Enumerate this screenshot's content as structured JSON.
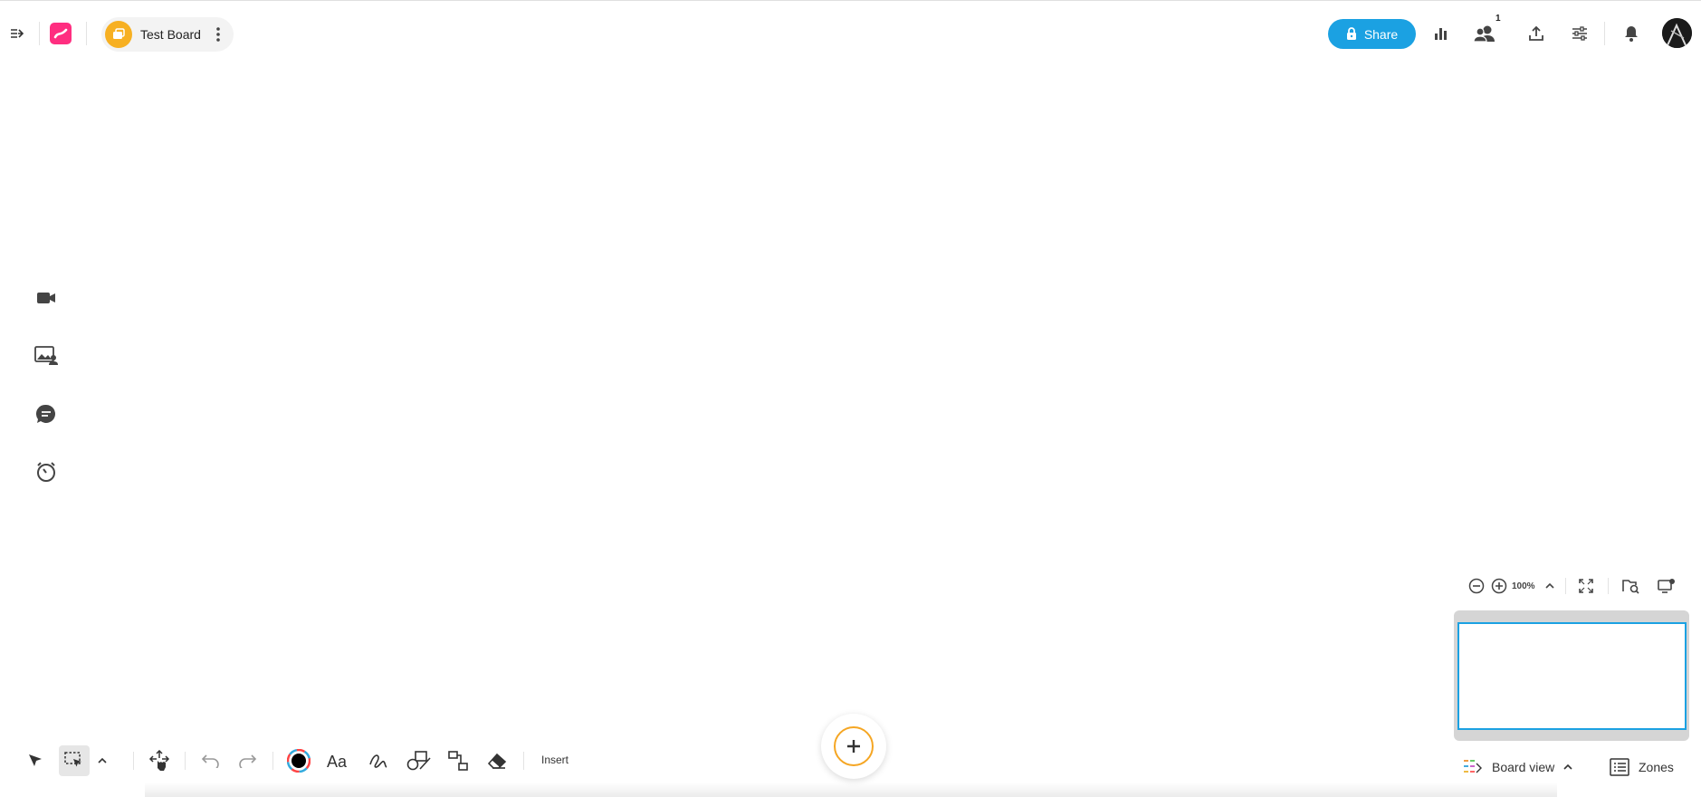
{
  "header": {
    "board_title": "Test Board",
    "share_label": "Share",
    "collaborators_count": "1"
  },
  "zoom": {
    "level": "100%"
  },
  "toolbar": {
    "insert_label": "Insert"
  },
  "footer": {
    "board_view_label": "Board view",
    "zones_label": "Zones"
  },
  "colors": {
    "brand_logo": "#ff2e80",
    "board_icon": "#f7b022",
    "share_button": "#1ba1e2",
    "fab_ring": "#f5a623",
    "minimap_frame": "#1ba1e2"
  },
  "icons": [
    "sidebar-toggle-icon",
    "app-logo-icon",
    "board-folder-icon",
    "more-vertical-icon",
    "lock-icon",
    "bar-chart-icon",
    "users-icon",
    "upload-icon",
    "sliders-icon",
    "bell-icon",
    "video-icon",
    "image-person-icon",
    "chat-icon",
    "timer-icon",
    "zoom-out-icon",
    "zoom-in-icon",
    "chevron-up-icon",
    "fullscreen-icon",
    "board-search-icon",
    "display-settings-icon",
    "pointer-icon",
    "select-area-icon",
    "pan-icon",
    "undo-icon",
    "redo-icon",
    "color-wheel-icon",
    "text-icon",
    "pen-icon",
    "shapes-icon",
    "connector-icon",
    "eraser-icon",
    "plus-icon",
    "board-view-icon",
    "zones-list-icon"
  ]
}
